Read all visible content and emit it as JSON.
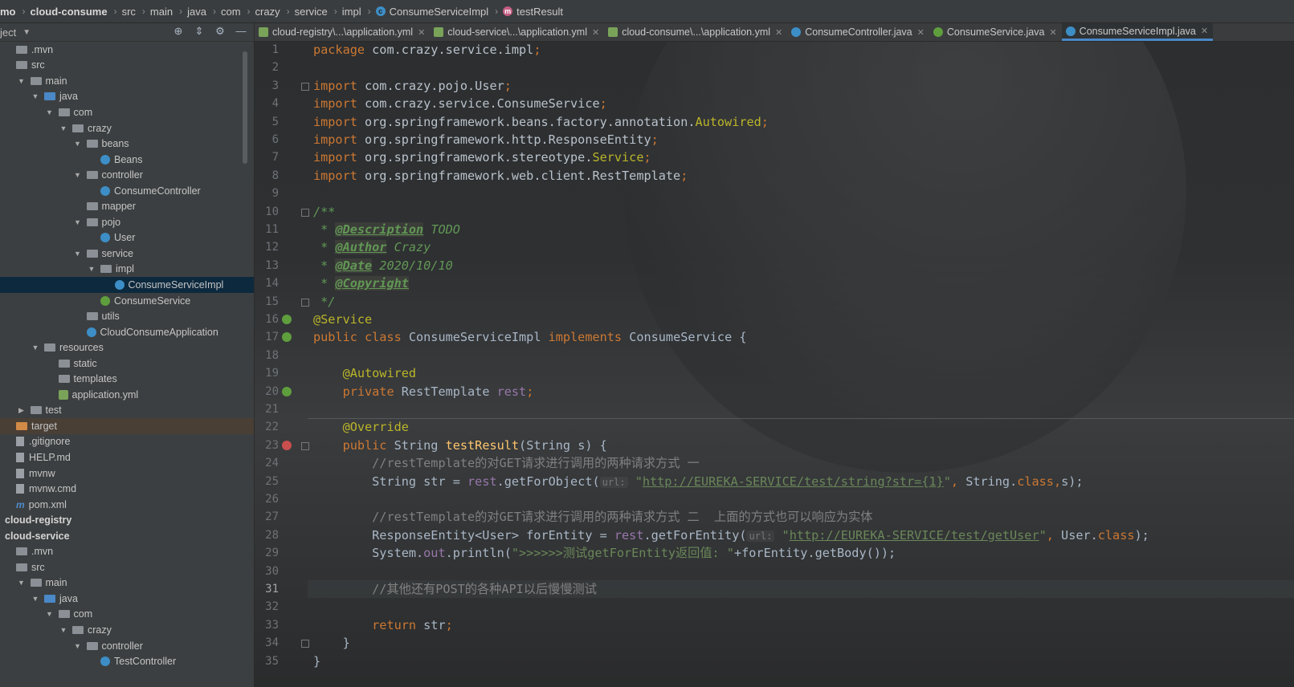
{
  "breadcrumb": {
    "items": [
      "mo",
      "cloud-consume",
      "src",
      "main",
      "java",
      "com",
      "crazy",
      "service",
      "impl",
      "ConsumeServiceImpl",
      "testResult"
    ]
  },
  "project_panel": {
    "title": "ject",
    "tree": [
      {
        "label": ".mvn",
        "indent": 0,
        "arrow": "",
        "icon": "folder"
      },
      {
        "label": "src",
        "indent": 0,
        "arrow": "",
        "icon": "folder"
      },
      {
        "label": "main",
        "indent": 1,
        "arrow": "down",
        "icon": "folder"
      },
      {
        "label": "java",
        "indent": 2,
        "arrow": "down",
        "icon": "folder-blue"
      },
      {
        "label": "com",
        "indent": 3,
        "arrow": "down",
        "icon": "folder"
      },
      {
        "label": "crazy",
        "indent": 4,
        "arrow": "down",
        "icon": "folder"
      },
      {
        "label": "beans",
        "indent": 5,
        "arrow": "down",
        "icon": "folder"
      },
      {
        "label": "Beans",
        "indent": 6,
        "arrow": "",
        "icon": "class"
      },
      {
        "label": "controller",
        "indent": 5,
        "arrow": "down",
        "icon": "folder"
      },
      {
        "label": "ConsumeController",
        "indent": 6,
        "arrow": "",
        "icon": "class"
      },
      {
        "label": "mapper",
        "indent": 5,
        "arrow": "",
        "icon": "folder"
      },
      {
        "label": "pojo",
        "indent": 5,
        "arrow": "down",
        "icon": "folder"
      },
      {
        "label": "User",
        "indent": 6,
        "arrow": "",
        "icon": "class"
      },
      {
        "label": "service",
        "indent": 5,
        "arrow": "down",
        "icon": "folder"
      },
      {
        "label": "impl",
        "indent": 6,
        "arrow": "down",
        "icon": "folder"
      },
      {
        "label": "ConsumeServiceImpl",
        "indent": 7,
        "arrow": "",
        "icon": "class",
        "selected": true
      },
      {
        "label": "ConsumeService",
        "indent": 6,
        "arrow": "",
        "icon": "interface"
      },
      {
        "label": "utils",
        "indent": 5,
        "arrow": "",
        "icon": "folder"
      },
      {
        "label": "CloudConsumeApplication",
        "indent": 5,
        "arrow": "",
        "icon": "class"
      },
      {
        "label": "resources",
        "indent": 2,
        "arrow": "down",
        "icon": "folder-res"
      },
      {
        "label": "static",
        "indent": 3,
        "arrow": "",
        "icon": "folder"
      },
      {
        "label": "templates",
        "indent": 3,
        "arrow": "",
        "icon": "folder"
      },
      {
        "label": "application.yml",
        "indent": 3,
        "arrow": "",
        "icon": "yml"
      },
      {
        "label": "test",
        "indent": 1,
        "arrow": "right",
        "icon": "folder"
      },
      {
        "label": "target",
        "indent": 0,
        "arrow": "",
        "icon": "folder-orange",
        "target": true
      },
      {
        "label": ".gitignore",
        "indent": 0,
        "arrow": "",
        "icon": "doc"
      },
      {
        "label": "HELP.md",
        "indent": 0,
        "arrow": "",
        "icon": "doc"
      },
      {
        "label": "mvnw",
        "indent": 0,
        "arrow": "",
        "icon": "doc"
      },
      {
        "label": "mvnw.cmd",
        "indent": 0,
        "arrow": "",
        "icon": "doc"
      },
      {
        "label": "pom.xml",
        "indent": 0,
        "arrow": "",
        "icon": "maven"
      },
      {
        "label": "cloud-registry",
        "indent": -1,
        "arrow": "",
        "icon": "none",
        "bold": true
      },
      {
        "label": "cloud-service",
        "indent": -1,
        "arrow": "",
        "icon": "none",
        "bold": true
      },
      {
        "label": ".mvn",
        "indent": 0,
        "arrow": "",
        "icon": "folder"
      },
      {
        "label": "src",
        "indent": 0,
        "arrow": "",
        "icon": "folder"
      },
      {
        "label": "main",
        "indent": 1,
        "arrow": "down",
        "icon": "folder"
      },
      {
        "label": "java",
        "indent": 2,
        "arrow": "down",
        "icon": "folder-blue"
      },
      {
        "label": "com",
        "indent": 3,
        "arrow": "down",
        "icon": "folder"
      },
      {
        "label": "crazy",
        "indent": 4,
        "arrow": "down",
        "icon": "folder"
      },
      {
        "label": "controller",
        "indent": 5,
        "arrow": "down",
        "icon": "folder"
      },
      {
        "label": "TestController",
        "indent": 6,
        "arrow": "",
        "icon": "class"
      }
    ]
  },
  "tabs": [
    {
      "label": "cloud-registry\\...\\application.yml",
      "icon": "yml"
    },
    {
      "label": "cloud-service\\...\\application.yml",
      "icon": "yml"
    },
    {
      "label": "cloud-consume\\...\\application.yml",
      "icon": "yml"
    },
    {
      "label": "ConsumeController.java",
      "icon": "class"
    },
    {
      "label": "ConsumeService.java",
      "icon": "interface"
    },
    {
      "label": "ConsumeServiceImpl.java",
      "icon": "class",
      "active": true
    }
  ],
  "editor": {
    "current_line": 31,
    "lines": [
      [
        [
          "kw",
          "package "
        ],
        [
          "pkg",
          "com.crazy.service.impl"
        ],
        [
          "kw",
          ";"
        ]
      ],
      [],
      [
        [
          "kw",
          "import "
        ],
        [
          "pkg",
          "com.crazy.pojo.User"
        ],
        [
          "kw",
          ";"
        ]
      ],
      [
        [
          "kw",
          "import "
        ],
        [
          "pkg",
          "com.crazy.service.ConsumeService"
        ],
        [
          "kw",
          ";"
        ]
      ],
      [
        [
          "kw",
          "import "
        ],
        [
          "pkg",
          "org.springframework.beans.factory.annotation."
        ],
        [
          "ann",
          "Autowired"
        ],
        [
          "kw",
          ";"
        ]
      ],
      [
        [
          "kw",
          "import "
        ],
        [
          "pkg",
          "org.springframework.http.ResponseEntity"
        ],
        [
          "kw",
          ";"
        ]
      ],
      [
        [
          "kw",
          "import "
        ],
        [
          "pkg",
          "org.springframework.stereotype."
        ],
        [
          "ann",
          "Service"
        ],
        [
          "kw",
          ";"
        ]
      ],
      [
        [
          "kw",
          "import "
        ],
        [
          "pkg",
          "org.springframework.web.client.RestTemplate"
        ],
        [
          "kw",
          ";"
        ]
      ],
      [],
      [
        [
          "doc",
          "/**"
        ]
      ],
      [
        [
          "doc",
          " * "
        ],
        [
          "tag",
          "@Description"
        ],
        [
          "doc",
          " TODO"
        ]
      ],
      [
        [
          "doc",
          " * "
        ],
        [
          "tag",
          "@Author"
        ],
        [
          "doc",
          " Crazy"
        ]
      ],
      [
        [
          "doc",
          " * "
        ],
        [
          "tag",
          "@Date"
        ],
        [
          "doc",
          " 2020/10/10"
        ]
      ],
      [
        [
          "doc",
          " * "
        ],
        [
          "tag",
          "@Copyright"
        ]
      ],
      [
        [
          "doc",
          " */"
        ]
      ],
      [
        [
          "ann",
          "@Service"
        ]
      ],
      [
        [
          "kw",
          "public class "
        ],
        [
          "plain",
          "ConsumeServiceImpl "
        ],
        [
          "kw",
          "implements "
        ],
        [
          "plain",
          "ConsumeService {"
        ]
      ],
      [],
      [
        [
          "plain",
          "    "
        ],
        [
          "ann",
          "@Autowired"
        ]
      ],
      [
        [
          "plain",
          "    "
        ],
        [
          "kw",
          "private "
        ],
        [
          "plain",
          "RestTemplate "
        ],
        [
          "field",
          "rest"
        ],
        [
          "kw",
          ";"
        ]
      ],
      [],
      [
        [
          "plain",
          "    "
        ],
        [
          "ann",
          "@Override"
        ]
      ],
      [
        [
          "plain",
          "    "
        ],
        [
          "kw",
          "public "
        ],
        [
          "plain",
          "String "
        ],
        [
          "meth",
          "testResult"
        ],
        [
          "plain",
          "(String s) {"
        ]
      ],
      [
        [
          "plain",
          "        "
        ],
        [
          "cmt",
          "//restTemplate的对GET请求进行调用的两种请求方式 一"
        ]
      ],
      [
        [
          "plain",
          "        String "
        ],
        [
          "plain",
          "str = "
        ],
        [
          "field",
          "rest"
        ],
        [
          "plain",
          "."
        ],
        [
          "plain",
          "getForObject("
        ],
        [
          "hint",
          "url:"
        ],
        [
          "plain",
          " "
        ],
        [
          "str",
          "\""
        ],
        [
          "url",
          "http://EUREKA-SERVICE/test/string?str={1}"
        ],
        [
          "str",
          "\""
        ],
        [
          "kw",
          ", "
        ],
        [
          "plain",
          "String."
        ],
        [
          "kw",
          "class"
        ],
        [
          "kw",
          ","
        ],
        [
          "plain",
          "s);"
        ]
      ],
      [],
      [
        [
          "plain",
          "        "
        ],
        [
          "cmt",
          "//restTemplate的对GET请求进行调用的两种请求方式 二  上面的方式也可以响应为实体"
        ]
      ],
      [
        [
          "plain",
          "        ResponseEntity<User> forEntity = "
        ],
        [
          "field",
          "rest"
        ],
        [
          "plain",
          ".getForEntity("
        ],
        [
          "hint",
          "url:"
        ],
        [
          "plain",
          " "
        ],
        [
          "str",
          "\""
        ],
        [
          "url",
          "http://EUREKA-SERVICE/test/getUser"
        ],
        [
          "str",
          "\""
        ],
        [
          "kw",
          ", "
        ],
        [
          "plain",
          "User."
        ],
        [
          "kw",
          "class"
        ],
        [
          "plain",
          ");"
        ]
      ],
      [
        [
          "plain",
          "        System."
        ],
        [
          "field",
          "out"
        ],
        [
          "plain",
          ".println("
        ],
        [
          "str",
          "\">>>>>>测试getForEntity返回值: \""
        ],
        [
          "plain",
          "+forEntity.getBody());"
        ]
      ],
      [],
      [
        [
          "plain",
          "        "
        ],
        [
          "cmt",
          "//其他还有POST的各种API以后慢慢测试"
        ]
      ],
      [],
      [
        [
          "plain",
          "        "
        ],
        [
          "kw",
          "return "
        ],
        [
          "plain",
          "str"
        ],
        [
          "kw",
          ";"
        ]
      ],
      [
        [
          "plain",
          "    }"
        ]
      ],
      [
        [
          "plain",
          "}"
        ]
      ]
    ]
  }
}
